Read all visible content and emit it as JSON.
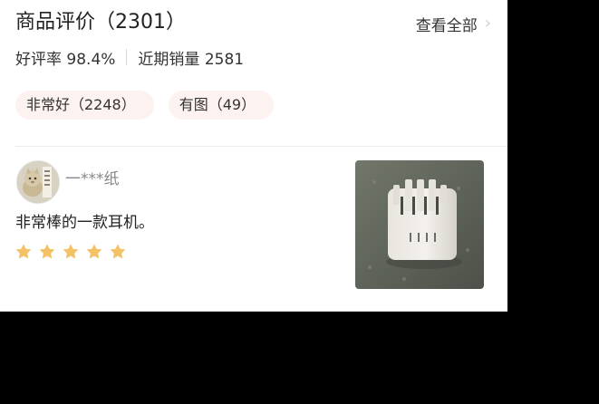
{
  "review_section": {
    "title": "商品评价（2301）",
    "view_all_label": "查看全部",
    "view_all_icon": "chevron-right-icon",
    "good_rate_label": "好评率 98.4%",
    "recent_sales_label": "近期销量 2581"
  },
  "filters": {
    "tags": [
      {
        "label": "非常好（2248）"
      },
      {
        "label": "有图（49）"
      }
    ]
  },
  "review": {
    "username": "一***纸",
    "text": "非常棒的一款耳机。",
    "rating": 5,
    "rating_max": 5,
    "star_color": "#f3c166",
    "avatar_icon": "user-avatar-photo",
    "photo_icon": "product-photo"
  },
  "colors": {
    "tag_background": "#fcf2ef",
    "outside_background": "#000000"
  }
}
